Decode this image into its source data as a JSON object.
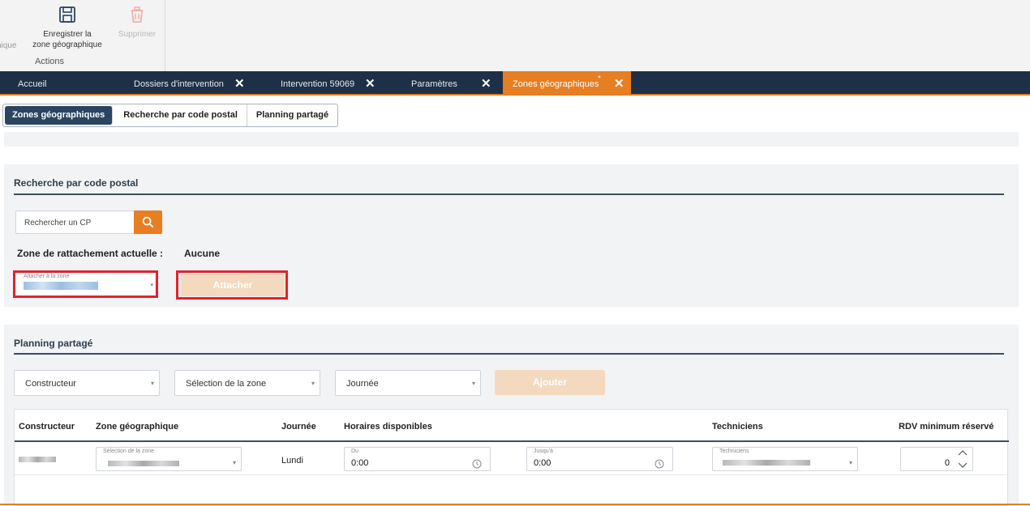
{
  "ribbon": {
    "cut_label": "nique",
    "save_label_line1": "Enregistrer la",
    "save_label_line2": "zone géographique",
    "delete_label": "Supprimer",
    "group_label": "Actions"
  },
  "tabs": [
    {
      "label": "Accueil",
      "closable": false,
      "active": false
    },
    {
      "label": "Dossiers d'intervention",
      "closable": true,
      "active": false
    },
    {
      "label": "Intervention 59069",
      "closable": true,
      "active": false
    },
    {
      "label": "Paramètres",
      "closable": true,
      "active": false
    },
    {
      "label": "Zones géographiques",
      "modified_mark": "*",
      "closable": true,
      "active": true
    }
  ],
  "close_glyph": "✕",
  "subnav": {
    "items": [
      "Zones géographiques",
      "Recherche par code postal",
      "Planning partagé"
    ],
    "selected": "Zones géographiques"
  },
  "recherche": {
    "title": "Recherche par code postal",
    "search_placeholder": "Rechercher un CP",
    "zone_label": "Zone de rattachement actuelle :",
    "zone_value": "Aucune",
    "attach_field_label": "Attacher à la zone",
    "attach_button": "Attacher"
  },
  "planning": {
    "title": "Planning partagé",
    "constructeur_placeholder": "Constructeur",
    "zone_placeholder": "Sélection de la zone",
    "journee_placeholder": "Journée",
    "add_button": "Ajouter",
    "columns": [
      "Constructeur",
      "Zone géographique",
      "Journée",
      "Horaires disponibles",
      "Techniciens",
      "RDV minimum réservé"
    ],
    "row": {
      "zone_label": "Sélection de la zone",
      "journee": "Lundi",
      "du_label": "Du",
      "du_value": "0:00",
      "jusqua_label": "Jusqu'à",
      "jusqua_value": "0:00",
      "techniciens_label": "Techniciens",
      "rdv_min": "0"
    }
  },
  "colors": {
    "accent": "#e67e22",
    "navy": "#1e3047",
    "highlight_red": "#e0232c"
  }
}
